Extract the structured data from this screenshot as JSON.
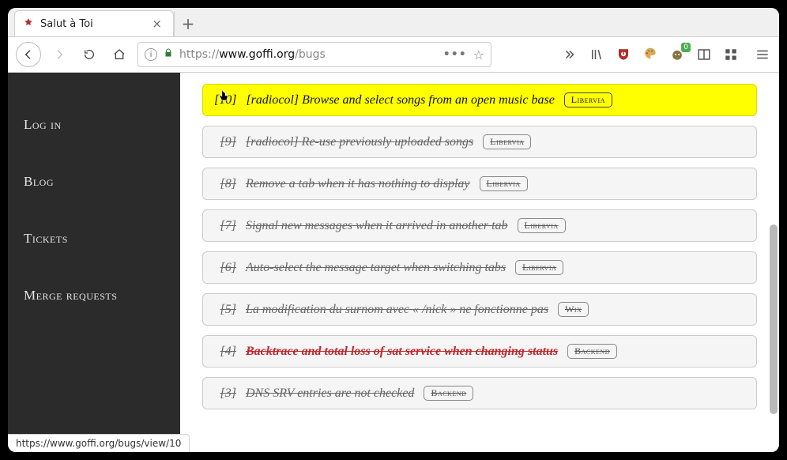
{
  "browser": {
    "tab_title": "Salut à Toi",
    "url_proto": "https://",
    "url_host": "www.goffi.org",
    "url_path": "/bugs",
    "status_text": "https://www.goffi.org/bugs/view/10",
    "gm_badge": "0"
  },
  "sidebar": {
    "items": [
      {
        "label": "Log in"
      },
      {
        "label": "Blog"
      },
      {
        "label": "Tickets"
      },
      {
        "label": "Merge requests"
      }
    ]
  },
  "tickets": [
    {
      "id": "[10]",
      "title": "[radiocol] Browse and select songs from an open music base",
      "tag": "Libervia",
      "status": "open",
      "highlight": true,
      "severity": "normal"
    },
    {
      "id": "[9]",
      "title": "[radiocol] Re-use previously uploaded songs",
      "tag": "Libervia",
      "status": "closed",
      "highlight": false,
      "severity": "normal"
    },
    {
      "id": "[8]",
      "title": "Remove a tab when it has nothing to display",
      "tag": "Libervia",
      "status": "closed",
      "highlight": false,
      "severity": "normal"
    },
    {
      "id": "[7]",
      "title": "Signal new messages when it arrived in another tab",
      "tag": "Libervia",
      "status": "closed",
      "highlight": false,
      "severity": "normal"
    },
    {
      "id": "[6]",
      "title": "Auto-select the message target when switching tabs",
      "tag": "Libervia",
      "status": "closed",
      "highlight": false,
      "severity": "normal"
    },
    {
      "id": "[5]",
      "title": "La modification du surnom avec « /nick » ne fonctionne pas",
      "tag": "Wix",
      "status": "closed",
      "highlight": false,
      "severity": "normal"
    },
    {
      "id": "[4]",
      "title": "Backtrace and total loss of sat service when changing status",
      "tag": "Backend",
      "status": "closed",
      "highlight": false,
      "severity": "major"
    },
    {
      "id": "[3]",
      "title": "DNS SRV entries are not checked",
      "tag": "Backend",
      "status": "closed",
      "highlight": false,
      "severity": "normal"
    }
  ]
}
